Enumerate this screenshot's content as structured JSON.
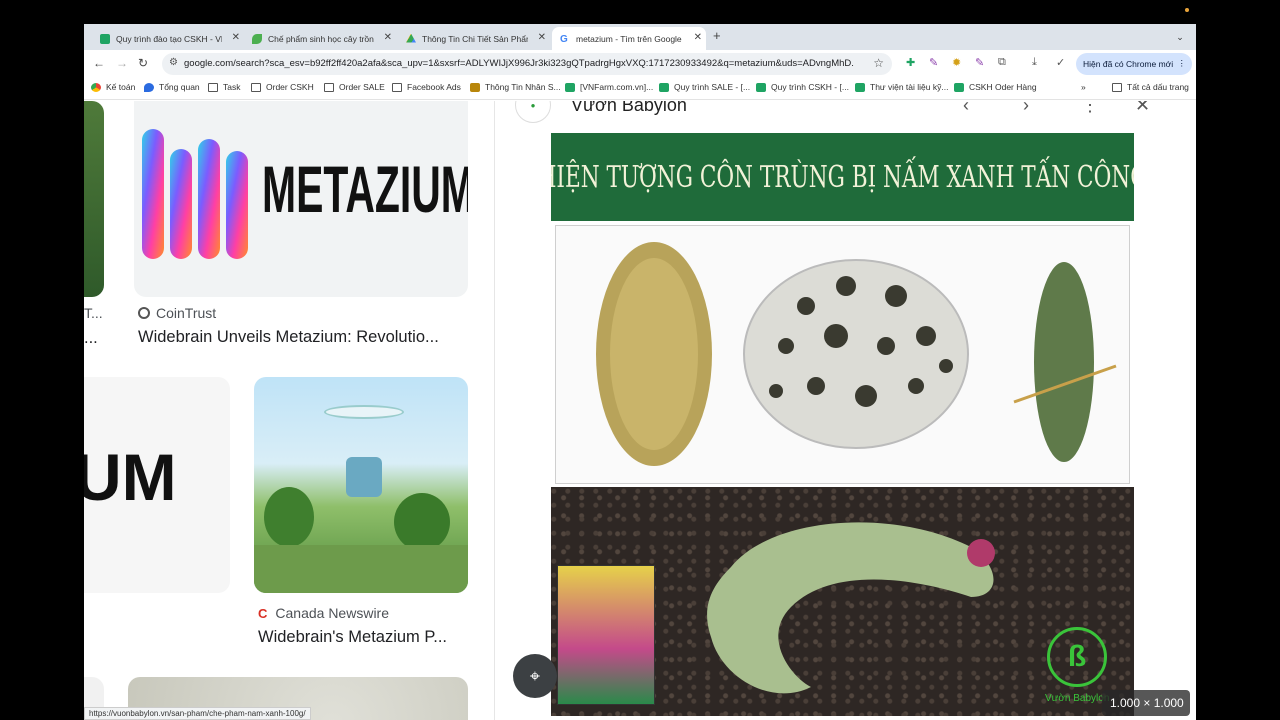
{
  "tabs": [
    {
      "label": "Quy trình đào tạo CSKH - VN",
      "icon": "sheets-icon"
    },
    {
      "label": "Chế phẩm sinh học cây trồng",
      "icon": "leaf-icon"
    },
    {
      "label": "Thông Tin Chi Tiết Sản Phẩm",
      "icon": "drive-icon"
    },
    {
      "label": "metazium - Tìm trên Google",
      "icon": "google-icon"
    }
  ],
  "new_tab": "+",
  "address": {
    "url": "google.com/search?sca_esv=b92ff2ff420a2afa&sca_upv=1&sxsrf=ADLYWIJjX996Jr3ki323gQTpadrgHgxVXQ:1717230933492&q=metazium&uds=ADvngMhD..."
  },
  "update_button": "Hiện đã có Chrome mới",
  "bookmarks": [
    {
      "label": "Kế toán",
      "icon": "chrome-icon"
    },
    {
      "label": "Tổng quan",
      "icon": "bird-icon"
    },
    {
      "label": "Task",
      "icon": "folder-icon"
    },
    {
      "label": "Order CSKH",
      "icon": "folder-icon"
    },
    {
      "label": "Order SALE",
      "icon": "folder-icon"
    },
    {
      "label": "Facebook Ads",
      "icon": "folder-icon"
    },
    {
      "label": "Thông Tin Nhân S...",
      "icon": "th-icon"
    },
    {
      "label": "[VNFarm.com.vn]...",
      "icon": "sheets-icon"
    },
    {
      "label": "Quy trình SALE - [...",
      "icon": "sheets-icon"
    },
    {
      "label": "Quy trình CSKH - [...",
      "icon": "sheets-icon"
    },
    {
      "label": "Thư viện tài liệu kỹ...",
      "icon": "sheets-icon"
    },
    {
      "label": "CSKH Oder Hàng",
      "icon": "sheets-icon"
    }
  ],
  "bookmarks_more": "»",
  "all_bookmarks": "Tất cả dấu trang",
  "results": {
    "card1": {
      "logo_text": "METAZIUM",
      "source": "CoinTrust",
      "caption": "Widebrain Unveils Metazium: Revolutio...",
      "partial_left_source": "T...",
      "partial_left_caption": "..."
    },
    "card2": {
      "logo_text": "UM"
    },
    "card3": {
      "source": "Canada Newswire",
      "caption": "Widebrain's Metazium P..."
    }
  },
  "panel": {
    "site_name": "Vườn Babylon",
    "image_banner": "HIỆN TƯỢNG CÔN TRÙNG BỊ NẤM XANH TẤN CÔNG",
    "watermark": "Vườn Babylon",
    "dimensions": "1.000 × 1.000"
  },
  "status_url": "https://vuonbabylon.vn/san-pham/che-pham-nam-xanh-100g/"
}
